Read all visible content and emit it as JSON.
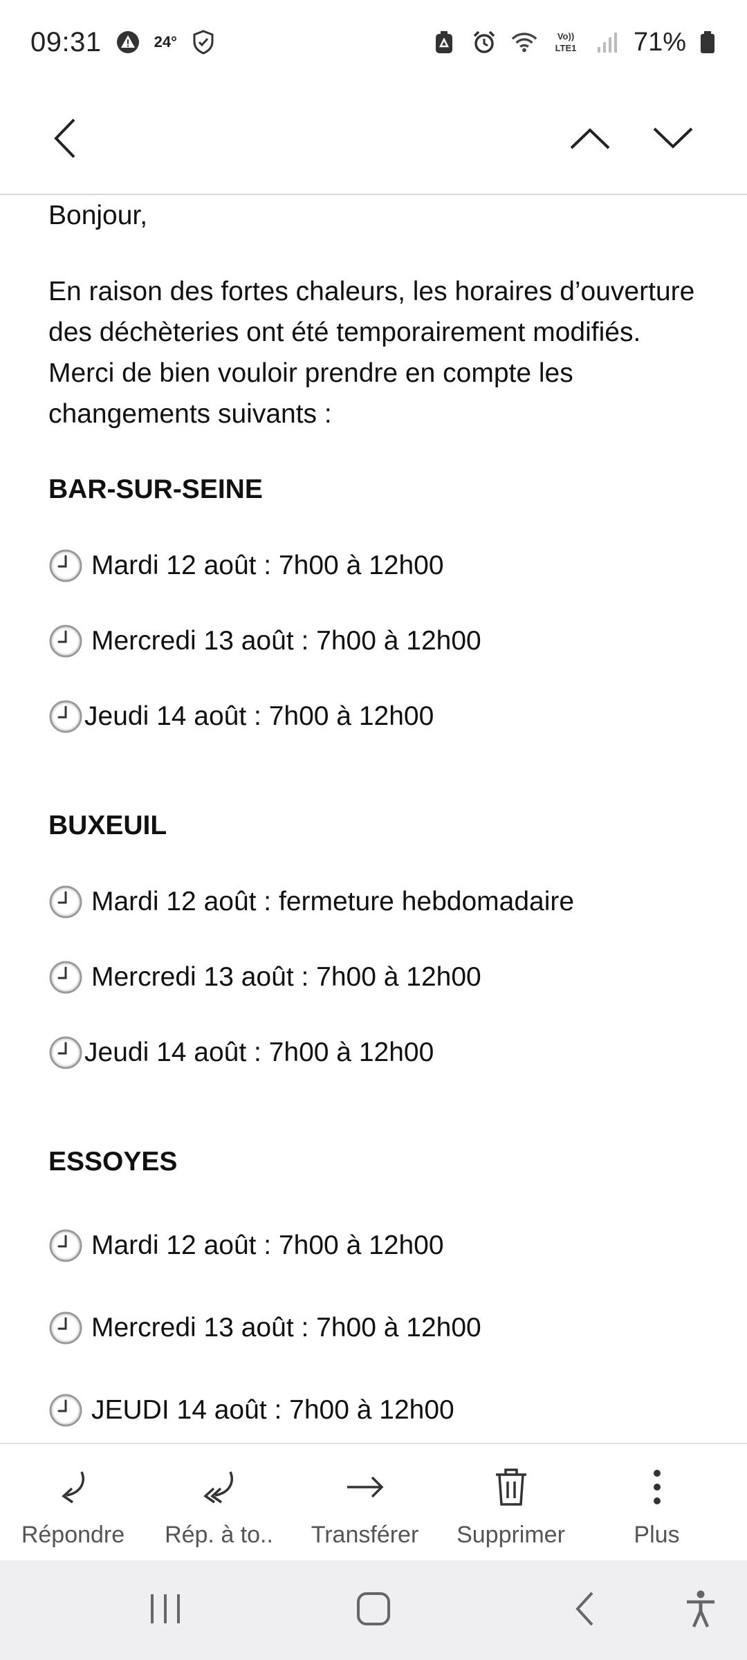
{
  "status_bar": {
    "time": "09:31",
    "temperature": "24°",
    "battery": "71%",
    "icons": [
      "warning-triangle-icon",
      "shield-icon",
      "recycle-icon",
      "alarm-icon",
      "wifi-icon",
      "volte-icon",
      "signal-icon",
      "battery-icon"
    ],
    "volte_label": "Vo)) LTE1"
  },
  "top_bar": {
    "back_icon": "chevron-left-icon",
    "prev_icon": "chevron-up-icon",
    "next_icon": "chevron-down-icon"
  },
  "email": {
    "greeting": "Bonjour,",
    "intro": "En raison des fortes chaleurs, les horaires d’ouverture des déchèteries ont été temporairement modifiés. Merci de bien vouloir prendre en compte les changements suivants :",
    "sections": [
      {
        "title": "BAR-SUR-SEINE",
        "items": [
          "Mardi 12 août : 7h00 à 12h00",
          "Mercredi 13 août : 7h00 à 12h00",
          "Jeudi 14 août : 7h00 à 12h00"
        ]
      },
      {
        "title": "BUXEUIL",
        "items": [
          "Mardi 12 août : fermeture hebdomadaire",
          "Mercredi 13 août : 7h00 à 12h00",
          "Jeudi 14 août : 7h00 à 12h00"
        ]
      },
      {
        "title": "ESSOYES",
        "items": [
          "Mardi 12 août : 7h00 à 12h00",
          "Mercredi 13 août : 7h00 à 12h00",
          "JEUDI 14 août : 7h00 à 12h00"
        ]
      }
    ]
  },
  "actions": [
    {
      "label": "Répondre",
      "icon": "reply-icon"
    },
    {
      "label": "Rép. à to..",
      "icon": "reply-all-icon"
    },
    {
      "label": "Transférer",
      "icon": "forward-icon"
    },
    {
      "label": "Supprimer",
      "icon": "trash-icon"
    },
    {
      "label": "Plus",
      "icon": "more-vertical-icon"
    }
  ],
  "nav_bar": {
    "icons": [
      "recent-apps-icon",
      "home-icon",
      "back-icon",
      "accessibility-icon"
    ]
  }
}
